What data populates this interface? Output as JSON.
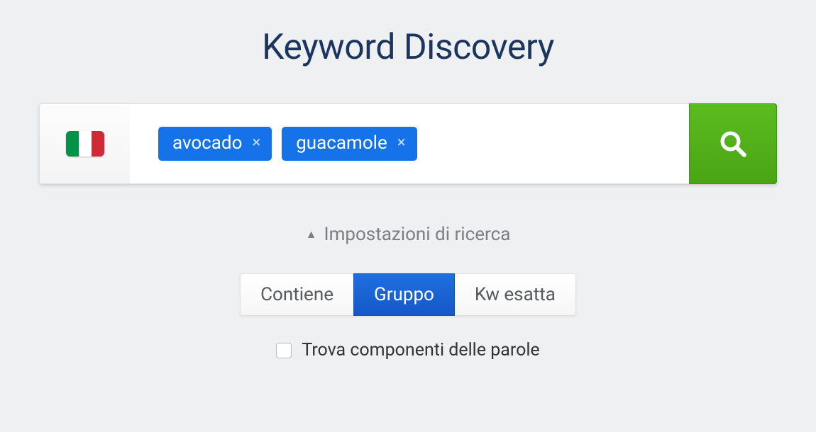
{
  "title": "Keyword Discovery",
  "flag": "it",
  "chips": [
    {
      "label": "avocado"
    },
    {
      "label": "guacamole"
    }
  ],
  "settings_toggle": "Impostazioni di ricerca",
  "segments": [
    {
      "label": "Contiene",
      "active": false
    },
    {
      "label": "Gruppo",
      "active": true
    },
    {
      "label": "Kw esatta",
      "active": false
    }
  ],
  "checkbox_label": "Trova componenti delle parole",
  "checkbox_checked": false
}
